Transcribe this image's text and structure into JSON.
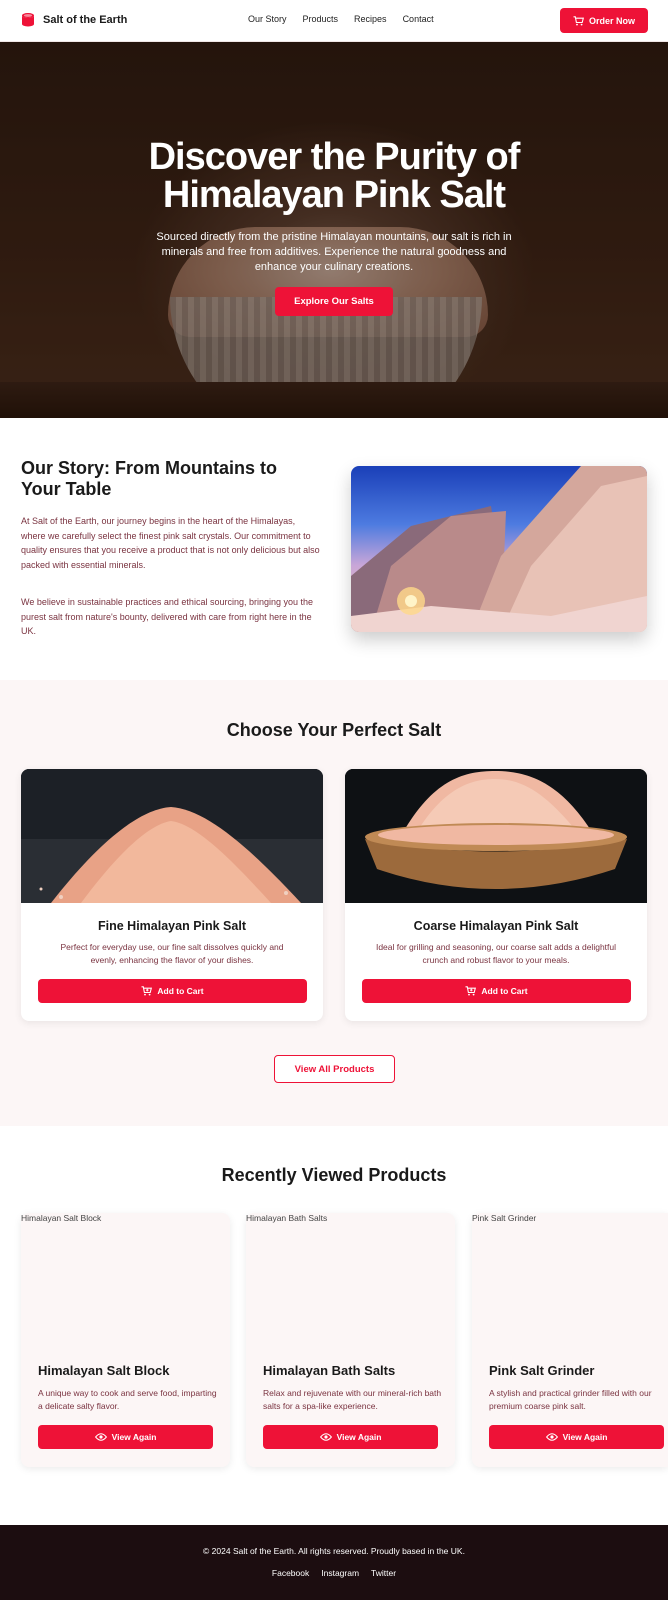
{
  "brand": {
    "name": "Salt of the Earth",
    "icon": "salt-shaker-icon"
  },
  "nav": {
    "items": [
      "Our Story",
      "Products",
      "Recipes",
      "Contact"
    ]
  },
  "header": {
    "order_label": "Order Now",
    "order_icon": "cart-icon"
  },
  "hero": {
    "title": "Discover the Purity of Himalayan Pink Salt",
    "subtitle": "Sourced directly from the pristine Himalayan mountains, our salt is rich in minerals and free from additives. Experience the natural goodness and enhance your culinary creations.",
    "cta": "Explore Our Salts"
  },
  "story": {
    "title": "Our Story: From Mountains to Your Table",
    "p1": "At Salt of the Earth, our journey begins in the heart of the Himalayas, where we carefully select the finest pink salt crystals. Our commitment to quality ensures that you receive a product that is not only delicious but also packed with essential minerals.",
    "p2": "We believe in sustainable practices and ethical sourcing, bringing you the purest salt from nature's bounty, delivered with care from right here in the UK."
  },
  "products": {
    "title": "Choose Your Perfect Salt",
    "items": [
      {
        "name": "Fine Himalayan Pink Salt",
        "desc": "Perfect for everyday use, our fine salt dissolves quickly and evenly, enhancing the flavor of your dishes.",
        "button": "Add to Cart"
      },
      {
        "name": "Coarse Himalayan Pink Salt",
        "desc": "Ideal for grilling and seasoning, our coarse salt adds a delightful crunch and robust flavor to your meals.",
        "button": "Add to Cart"
      }
    ],
    "view_all": "View All Products"
  },
  "recent": {
    "title": "Recently Viewed Products",
    "items": [
      {
        "alt": "Himalayan Salt Block",
        "name": "Himalayan Salt Block",
        "desc": "A unique way to cook and serve food, imparting a delicate salty flavor.",
        "button": "View Again"
      },
      {
        "alt": "Himalayan Bath Salts",
        "name": "Himalayan Bath Salts",
        "desc": "Relax and rejuvenate with our mineral-rich bath salts for a spa-like experience.",
        "button": "View Again"
      },
      {
        "alt": "Pink Salt Grinder",
        "name": "Pink Salt Grinder",
        "desc": "A stylish and practical grinder filled with our premium coarse pink salt.",
        "button": "View Again"
      }
    ]
  },
  "footer": {
    "copyright": "© 2024 Salt of the Earth. All rights reserved. Proudly based in the UK.",
    "links": [
      "Facebook",
      "Instagram",
      "Twitter"
    ]
  },
  "colors": {
    "accent": "#ee1237",
    "text_muted": "#7a3340",
    "footer_bg": "#1c0d10",
    "section_bg": "#fcf6f6"
  }
}
